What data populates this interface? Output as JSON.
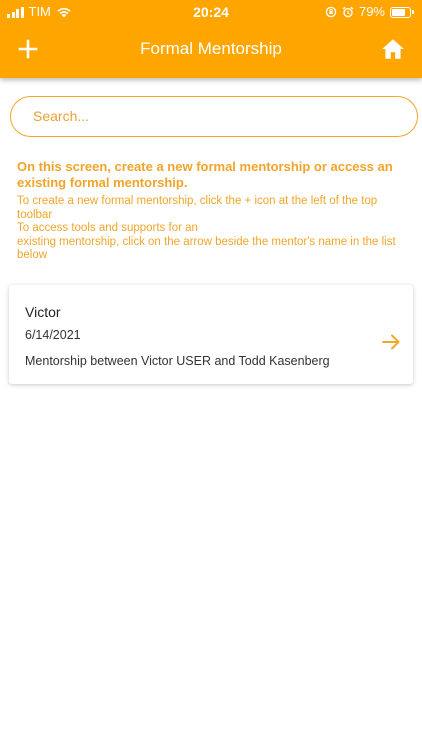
{
  "status_bar": {
    "carrier": "TIM",
    "time": "20:24",
    "battery_percent": "79%",
    "battery_level": 0.79
  },
  "toolbar": {
    "title": "Formal Mentorship",
    "add_icon": "plus-icon",
    "home_icon": "home-icon"
  },
  "search": {
    "placeholder": "Search...",
    "value": ""
  },
  "instructions": {
    "intro": "On this screen, create a new formal mentorship or access an existing formal mentorship.",
    "create_help": "To create a new formal mentorship, click the + icon at the left of the top toolbar",
    "access_help_line1": "To access tools and supports for an",
    "access_help_line2": "existing mentorship, click on the arrow beside the mentor's name in the list below"
  },
  "mentorships": [
    {
      "mentor": "Victor",
      "date": "6/14/2021",
      "description": "Mentorship between Victor USER and Todd Kasenberg",
      "arrow_icon": "arrow-right-icon"
    }
  ],
  "colors": {
    "primary": "#FFA500",
    "accent_text": "#F0A52A",
    "arrow": "#F2A62C"
  }
}
